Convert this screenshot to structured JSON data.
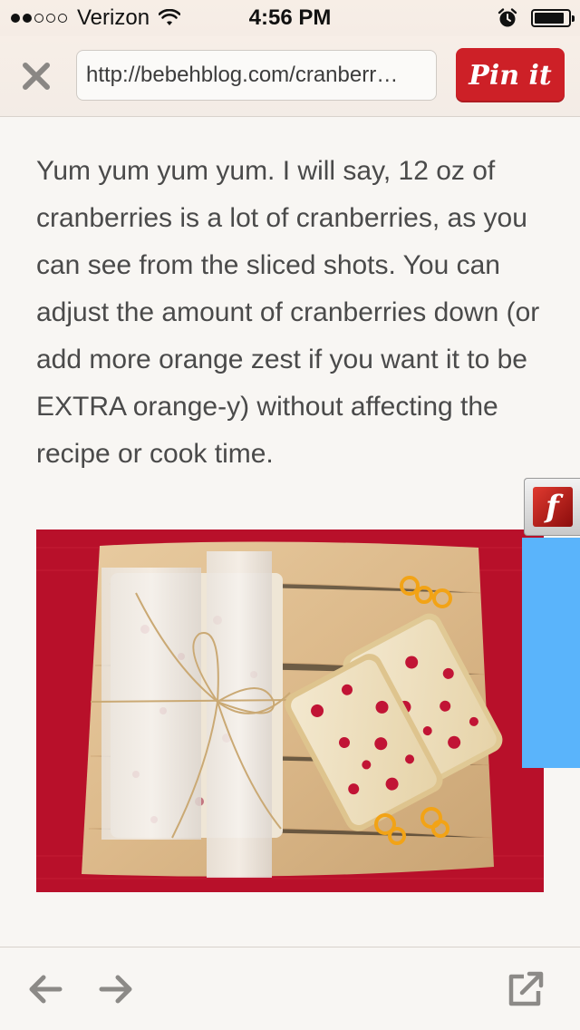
{
  "status_bar": {
    "carrier": "Verizon",
    "time": "4:56 PM",
    "signal_bars_filled": 2,
    "signal_bars_total": 5,
    "battery_level": 0.9
  },
  "toolbar": {
    "url": "http://bebehblog.com/cranberr…",
    "pin_button_label": "Pin it",
    "close_icon": "close-x-icon",
    "pin_button_color": "#cd2027"
  },
  "article": {
    "paragraph": "Yum yum yum yum. I will say, 12 oz of cranberries is a lot of cranberries, as you can see from the sliced shots. You can adjust the amount of cranberries down (or add more orange zest if you want it to be EXTRA orange-y) without affecting the recipe or cook time."
  },
  "flash_badge": {
    "letter": "f",
    "icon": "adobe-flash-icon"
  },
  "side_panel": {
    "color": "#5ab4fb"
  },
  "bottom_bar": {
    "back_icon": "arrow-left-icon",
    "forward_icon": "arrow-right-icon",
    "share_icon": "open-external-icon"
  }
}
